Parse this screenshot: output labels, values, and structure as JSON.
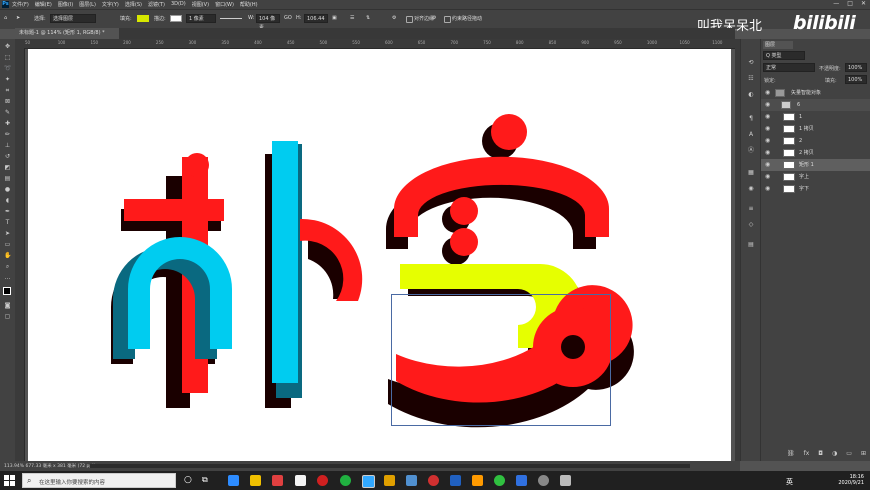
{
  "menubar": {
    "logo": "Ps",
    "menus": [
      "文件(F)",
      "编辑(E)",
      "图像(I)",
      "图层(L)",
      "文字(Y)",
      "选择(S)",
      "滤镜(T)",
      "3D(D)",
      "视图(V)",
      "窗口(W)",
      "帮助(H)"
    ],
    "window_buttons": [
      "—",
      "□",
      "✕"
    ]
  },
  "options": {
    "select_label": "选择:",
    "select_value": "选择图层",
    "fill_label": "填充:",
    "fill_color": "#d7e800",
    "stroke_label": "描边:",
    "stroke_width": "1 像素",
    "w_label": "W:",
    "w_value": "104 像素",
    "link_label": "GO",
    "h_label": "H:",
    "h_value": "106.44",
    "align_edges": "对齐边缘",
    "constrain_path": "约束路径拖动"
  },
  "document": {
    "tab_title": "未标题-1 @ 114% (矩形 1, RGB/8) *",
    "zoom_status": "113.94%   677.33 毫米 x 381 毫米 (72 ppi)"
  },
  "ruler": {
    "h_marks": [
      "50",
      "100",
      "150",
      "200",
      "250",
      "300",
      "350",
      "400",
      "450",
      "500",
      "550",
      "600",
      "650",
      "700",
      "750",
      "800",
      "850",
      "900",
      "950",
      "1000",
      "1050",
      "1100"
    ]
  },
  "artwork": {
    "colors": {
      "red": "#ff1a1a",
      "cyan": "#00ccf0",
      "teal": "#0a6980",
      "yellow": "#e6ff00",
      "shadow": "#1a0000",
      "selection": "#4a6aa3"
    }
  },
  "layers_panel": {
    "tab_label": "图层",
    "filter_label": "Q 类型",
    "blend_mode": "正常",
    "opacity_label": "不透明度:",
    "opacity_value": "100%",
    "lock_label": "锁定:",
    "fill_label": "填充:",
    "fill_value": "100%",
    "layers": [
      {
        "name": "矢量智能对象",
        "kind": "smart"
      },
      {
        "name": "6",
        "kind": "group"
      },
      {
        "name": "1",
        "kind": "layer"
      },
      {
        "name": "1 拷贝",
        "kind": "layer"
      },
      {
        "name": "2",
        "kind": "layer"
      },
      {
        "name": "2 拷贝",
        "kind": "layer"
      },
      {
        "name": "矩形 1",
        "kind": "layer"
      },
      {
        "name": "字上",
        "kind": "layer"
      },
      {
        "name": "字下",
        "kind": "layer"
      }
    ],
    "bottom_icons": [
      "link-icon",
      "fx-icon",
      "mask-icon",
      "adjustment-icon",
      "folder-icon",
      "new-layer-icon",
      "trash-icon"
    ]
  },
  "watermark": {
    "text": "叫我呆呆北",
    "logo": "bilibili"
  },
  "taskbar": {
    "search_placeholder": "在这里输入你要搜索的内容",
    "lang": "英",
    "time": "18:16",
    "date": "2020/9/21"
  }
}
